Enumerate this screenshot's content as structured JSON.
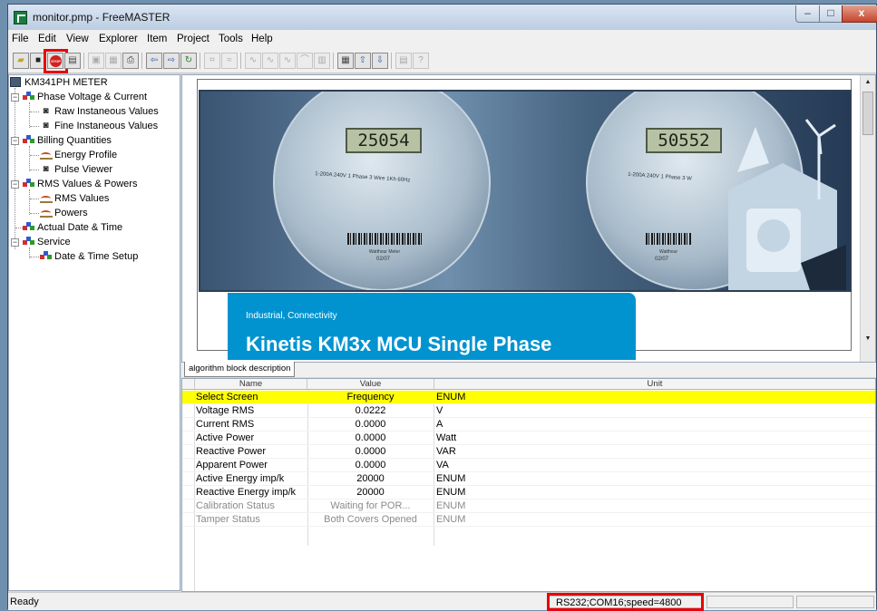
{
  "window": {
    "title": "monitor.pmp - FreeMASTER",
    "minimize_glyph": "–",
    "maximize_glyph": "□",
    "close_glyph": "x"
  },
  "menubar": {
    "items": [
      "File",
      "Edit",
      "View",
      "Explorer",
      "Item",
      "Project",
      "Tools",
      "Help"
    ]
  },
  "toolbar": {
    "stop_label": "STOP",
    "stop_highlight_color": "#e8000b",
    "buttons": [
      "open-icon",
      "save-icon",
      "stop-icon",
      "options-icon",
      "copy-icon",
      "paste-icon",
      "print-icon",
      "back-icon",
      "forward-icon",
      "refresh-icon",
      "watch-icon",
      "variable-icon",
      "recorder-icon",
      "scope-icon",
      "stimulus-icon",
      "item-icon",
      "settings-icon",
      "grid-icon",
      "arrow-up-icon",
      "arrow-down-icon",
      "properties-icon",
      "help-icon"
    ]
  },
  "tree": {
    "root": "KM341PH METER",
    "items": [
      {
        "label": "Phase Voltage & Current",
        "icon": "folder-icon",
        "level": 1,
        "expanded": true
      },
      {
        "label": "Raw Instaneous Values",
        "icon": "binoculars-icon",
        "level": 2
      },
      {
        "label": "Fine Instaneous Values",
        "icon": "binoculars-icon",
        "level": 2
      },
      {
        "label": "Billing Quantities",
        "icon": "folder-icon",
        "level": 1,
        "expanded": true
      },
      {
        "label": "Energy Profile",
        "icon": "scope-icon",
        "level": 2
      },
      {
        "label": "Pulse Viewer",
        "icon": "binoculars-icon",
        "level": 2
      },
      {
        "label": "RMS Values & Powers",
        "icon": "folder-icon",
        "level": 1,
        "expanded": true
      },
      {
        "label": "RMS Values",
        "icon": "scope-icon",
        "level": 2
      },
      {
        "label": "Powers",
        "icon": "scope-icon",
        "level": 2
      },
      {
        "label": "Actual Date & Time",
        "icon": "folder-icon",
        "level": 1,
        "expanded": false
      },
      {
        "label": "Service",
        "icon": "folder-icon",
        "level": 1,
        "expanded": true
      },
      {
        "label": "Date & Time Setup",
        "icon": "folder-icon",
        "level": 2
      }
    ]
  },
  "content": {
    "meter1_reading": "25054",
    "meter1_rating": "1-200A 240V 1 Phase 3 Wire 1Kh 60Hz",
    "meter1_caption": "Watthour Meter",
    "meter1_date": "02/07",
    "meter2_reading": "50552",
    "meter2_rating": "1-200A 240V 1 Phase 3 W",
    "meter2_caption": "Watthour",
    "meter2_date": "02/07",
    "brochure_tag": "Industrial, Connectivity",
    "brochure_title": "Kinetis KM3x MCU Single Phase",
    "tab_label": "algorithm block description"
  },
  "grid": {
    "headers": [
      "Name",
      "Value",
      "Unit"
    ],
    "highlight_color": "#ffff00",
    "rows": [
      {
        "name": "Select Screen",
        "value": "Frequency",
        "unit": "ENUM",
        "selected": true
      },
      {
        "name": "Voltage RMS",
        "value": "0.0222",
        "unit": "V"
      },
      {
        "name": "Current RMS",
        "value": "0.0000",
        "unit": "A"
      },
      {
        "name": "Active Power",
        "value": "0.0000",
        "unit": "Watt"
      },
      {
        "name": "Reactive Power",
        "value": "0.0000",
        "unit": "VAR"
      },
      {
        "name": "Apparent Power",
        "value": "0.0000",
        "unit": "VA"
      },
      {
        "name": "Active Energy imp/k",
        "value": "20000",
        "unit": "ENUM"
      },
      {
        "name": "Reactive Energy imp/k",
        "value": "20000",
        "unit": "ENUM"
      },
      {
        "name": "Calibration Status",
        "value": "Waiting for POR...",
        "unit": "ENUM",
        "dim": true
      },
      {
        "name": "Tamper Status",
        "value": "Both Covers Opened",
        "unit": "ENUM",
        "dim": true
      }
    ]
  },
  "statusbar": {
    "status": "Ready",
    "connection": "RS232;COM16;speed=4800",
    "connection_highlight_color": "#e8000b"
  }
}
